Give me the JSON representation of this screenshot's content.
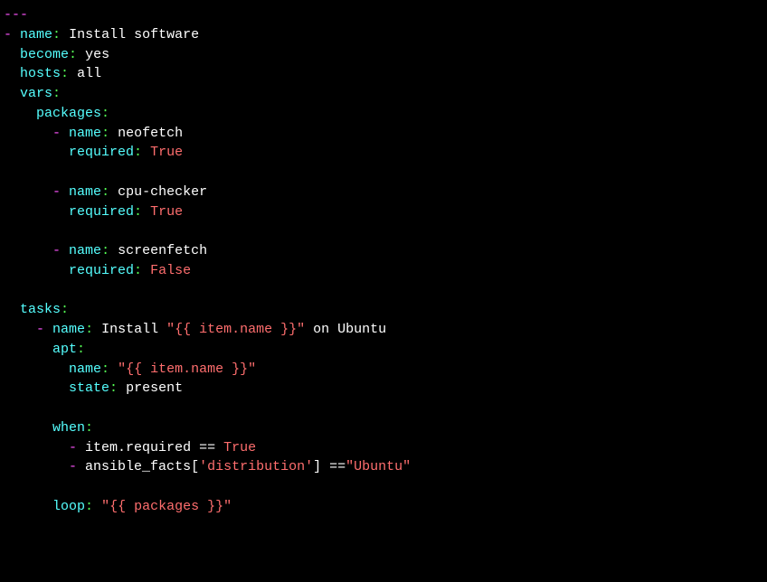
{
  "doc_start": "---",
  "play": {
    "name_key": "name",
    "name_val": "Install software",
    "become_key": "become",
    "become_val": "yes",
    "hosts_key": "hosts",
    "hosts_val": "all",
    "vars_key": "vars",
    "packages_key": "packages",
    "packages": [
      {
        "name_key": "name",
        "name_val": "neofetch",
        "req_key": "required",
        "req_val": "True"
      },
      {
        "name_key": "name",
        "name_val": "cpu-checker",
        "req_key": "required",
        "req_val": "True"
      },
      {
        "name_key": "name",
        "name_val": "screenfetch",
        "req_key": "required",
        "req_val": "False"
      }
    ],
    "tasks_key": "tasks",
    "task": {
      "name_key": "name",
      "name_prefix": "Install ",
      "name_jinja": "\"{{ item.name }}\"",
      "name_suffix": " on Ubuntu",
      "apt_key": "apt",
      "apt_name_key": "name",
      "apt_name_val": "\"{{ item.name }}\"",
      "apt_state_key": "state",
      "apt_state_val": "present",
      "when_key": "when",
      "when_cond1_a": "item.required == ",
      "when_cond1_b": "True",
      "when_cond2_a": "ansible_facts[",
      "when_cond2_b": "'distribution'",
      "when_cond2_c": "] ==",
      "when_cond2_d": "\"Ubuntu\"",
      "loop_key": "loop",
      "loop_val": "\"{{ packages }}\""
    }
  }
}
